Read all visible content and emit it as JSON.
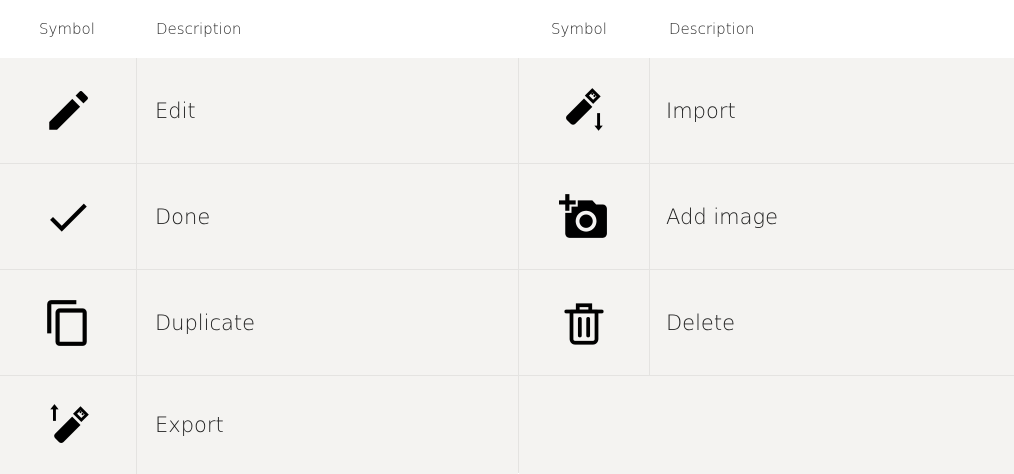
{
  "left": {
    "header": {
      "symbol": "Symbol",
      "description": "Description"
    },
    "rows": [
      {
        "icon": "pencil-icon",
        "label": "Edit"
      },
      {
        "icon": "check-icon",
        "label": "Done"
      },
      {
        "icon": "copy-icon",
        "label": "Duplicate"
      },
      {
        "icon": "usb-upload-icon",
        "label": "Export"
      }
    ]
  },
  "right": {
    "header": {
      "symbol": "Symbol",
      "description": "Description"
    },
    "rows": [
      {
        "icon": "usb-download-icon",
        "label": "Import"
      },
      {
        "icon": "add-photo-icon",
        "label": "Add image"
      },
      {
        "icon": "trash-icon",
        "label": "Delete"
      }
    ]
  }
}
